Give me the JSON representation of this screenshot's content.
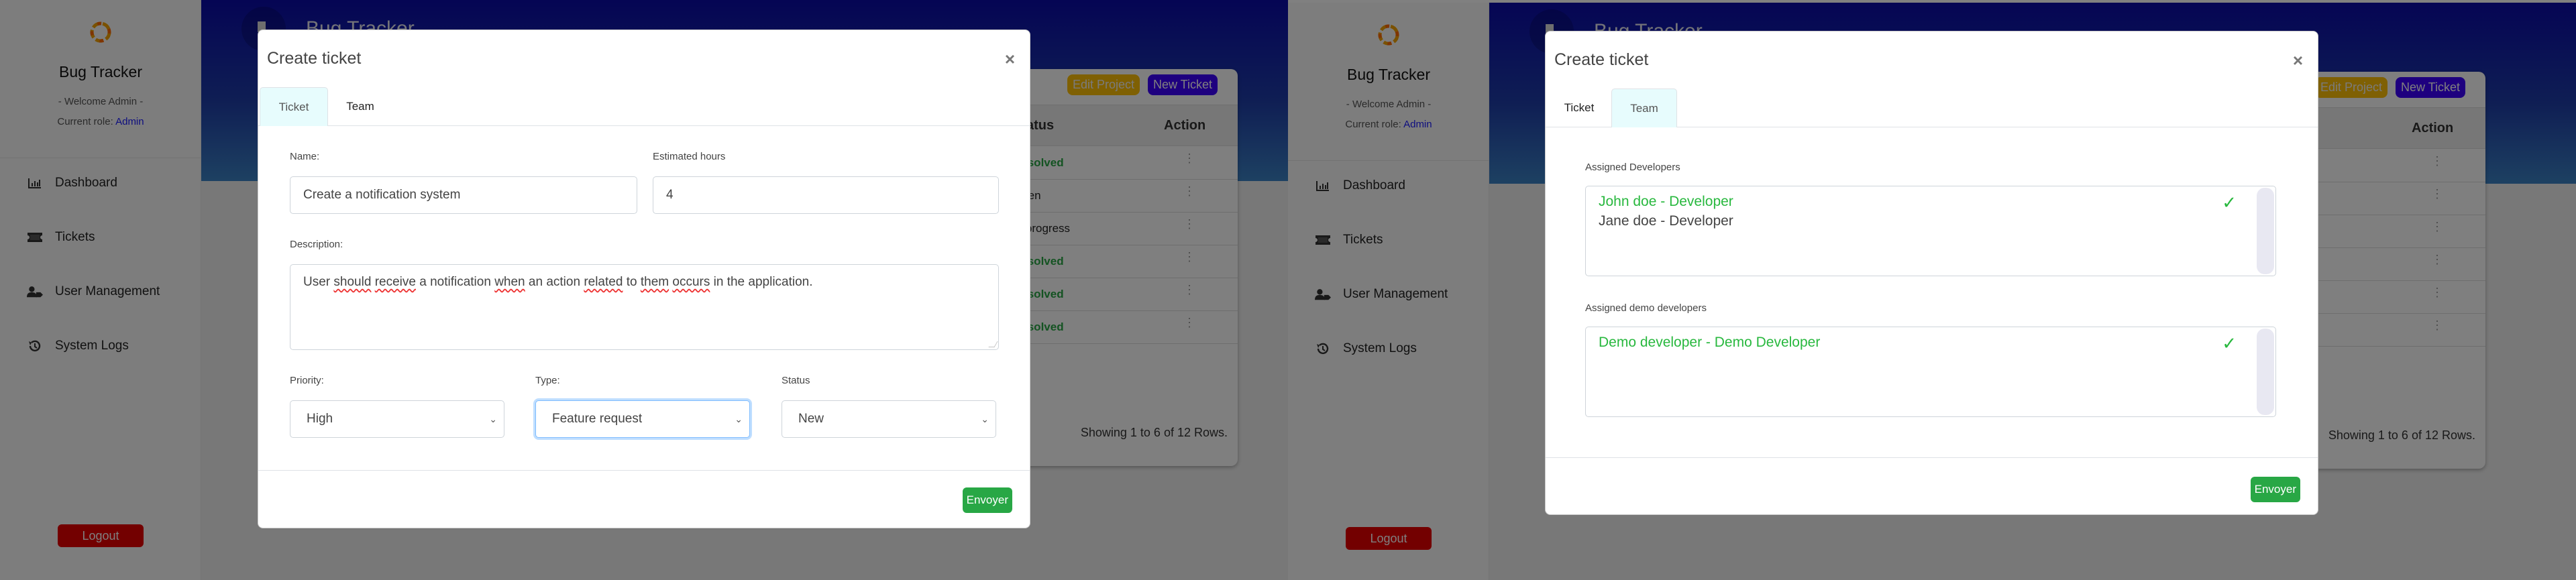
{
  "app": {
    "brand": "Bug Tracker",
    "welcome": "- Welcome Admin -",
    "role_prefix": "Current role: ",
    "role": "Admin",
    "header_title": "Bug Tracker"
  },
  "sidebar": {
    "items": [
      {
        "label": "Dashboard",
        "icon": "bar-chart-icon"
      },
      {
        "label": "Tickets",
        "icon": "ticket-icon"
      },
      {
        "label": "User Management",
        "icon": "user-tag-icon"
      },
      {
        "label": "System Logs",
        "icon": "history-icon"
      }
    ],
    "logout_label": "Logout"
  },
  "background_table": {
    "edit_project_label": "Edit Project",
    "new_ticket_label": "New Ticket",
    "columns": [
      "Status",
      "Action"
    ],
    "rows": [
      {
        "status": "Resolved",
        "status_visible": "esolved"
      },
      {
        "status": "Open",
        "status_visible": "pen"
      },
      {
        "status": "In progress",
        "status_visible": "n progress"
      },
      {
        "status": "Resolved",
        "status_visible": "esolved"
      },
      {
        "status": "Resolved",
        "status_visible": "esolved"
      },
      {
        "status": "Resolved",
        "status_visible": "esolved"
      }
    ],
    "action_icon": "more-vertical-icon",
    "footer": "Showing 1 to 6 of 12 Rows."
  },
  "modal": {
    "title": "Create ticket",
    "close_glyph": "×",
    "tabs": [
      "Ticket",
      "Team"
    ],
    "submit_label": "Envoyer"
  },
  "ticket_tab": {
    "name_label": "Name:",
    "name_value": "Create a notification system",
    "hours_label": "Estimated hours",
    "hours_value": "4",
    "description_label": "Description:",
    "description_words": [
      {
        "w": "User",
        "spell": false
      },
      {
        "w": "should",
        "spell": true
      },
      {
        "w": "receive",
        "spell": true
      },
      {
        "w": "a",
        "spell": false
      },
      {
        "w": "notification",
        "spell": false
      },
      {
        "w": "when",
        "spell": true
      },
      {
        "w": "an",
        "spell": false
      },
      {
        "w": "action",
        "spell": false
      },
      {
        "w": "related",
        "spell": true
      },
      {
        "w": "to",
        "spell": false
      },
      {
        "w": "them",
        "spell": true
      },
      {
        "w": "occurs",
        "spell": true
      },
      {
        "w": "in",
        "spell": false
      },
      {
        "w": "the",
        "spell": false
      },
      {
        "w": "application.",
        "spell": false
      }
    ],
    "priority_label": "Priority:",
    "priority_value": "High",
    "type_label": "Type:",
    "type_value": "Feature request",
    "status_label": "Status",
    "status_value": "New"
  },
  "team_tab": {
    "developers_label": "Assigned Developers",
    "developers": [
      {
        "label": "John doe - Developer",
        "selected": true
      },
      {
        "label": "Jane doe - Developer",
        "selected": false
      }
    ],
    "demo_label": "Assigned demo developers",
    "demo_developers": [
      {
        "label": "Demo developer - Demo Developer",
        "selected": true
      }
    ],
    "check_glyph": "✓"
  },
  "colors": {
    "success": "#28a745",
    "selected_option": "#28b83e",
    "logout": "#e60000",
    "edit_project": "#ffc107",
    "new_ticket": "#3d00ff",
    "role_link": "#1a1aff",
    "active_tab": "#e7fcfd"
  }
}
